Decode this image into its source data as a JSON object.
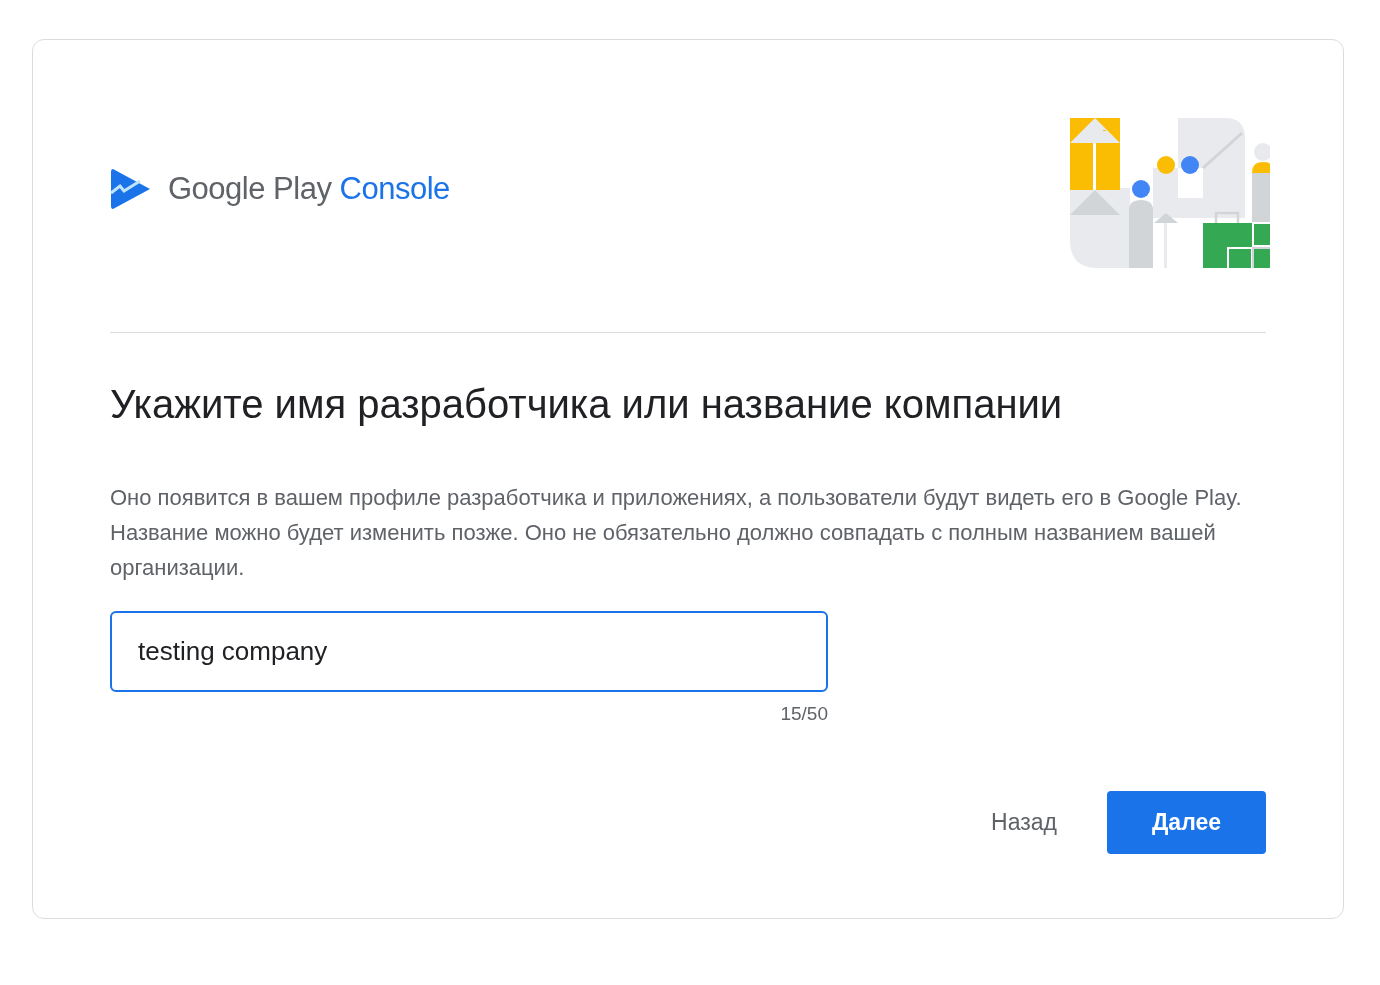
{
  "logo": {
    "brand": "Google Play",
    "product": "Console"
  },
  "heading": "Укажите имя разработчика или название компании",
  "description": "Оно появится в вашем профиле разработчика и приложениях, а пользователи будут видеть его в Google Play. Название можно будет изменить позже. Оно не обязательно должно совпадать с полным названием вашей организации.",
  "name_field": {
    "value": "testing company",
    "focused": true,
    "counter": "15/50"
  },
  "buttons": [
    {
      "label": "Назад",
      "kind": "text"
    },
    {
      "label": "Далее",
      "kind": "primary"
    }
  ]
}
